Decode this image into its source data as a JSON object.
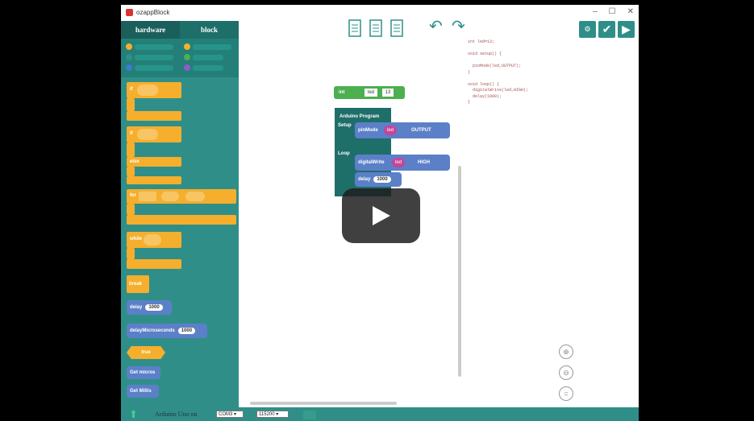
{
  "window": {
    "title": "ozappBlock",
    "controls": [
      "–",
      "☐",
      "✕"
    ]
  },
  "palette": {
    "tabs": [
      {
        "label": "hardware"
      },
      {
        "label": "block"
      }
    ],
    "legend_colors": [
      "#f6ae2d",
      "#2f8f88",
      "#3a7bd5",
      "#f6ae2d",
      "#4caf50",
      "#8e5bc8"
    ],
    "blocks": {
      "if_label": "if",
      "else_label": "else",
      "for_label": "for",
      "while_label": "while",
      "break_label": "break",
      "delay_label": "delay",
      "delay_value": "1000",
      "delay_us_label": "delayMicroseconds",
      "delay_us_value": "1000",
      "true_label": "true",
      "get_micros_label": "Get micros",
      "get_millis_label": "Get Millis"
    }
  },
  "toolbar": {
    "file_icons": [
      "new-file-icon",
      "open-file-icon",
      "save-file-icon"
    ],
    "undo_icon": "↶",
    "redo_icon": "↷",
    "right_buttons": [
      "code-toggle-icon",
      "verify-icon",
      "upload-icon"
    ]
  },
  "workspace": {
    "int_block": {
      "type": "int",
      "name": "led",
      "value": "13"
    },
    "program": {
      "title": "Arduino Program",
      "setup_label": "Setup",
      "loop_label": "Loop",
      "pinmode": {
        "label": "pinMode",
        "pin": "led",
        "mode": "OUTPUT"
      },
      "digitalwrite": {
        "label": "digitalWrite",
        "pin": "led",
        "value": "HIGH"
      },
      "delay": {
        "label": "delay",
        "value": "1000"
      }
    }
  },
  "code": {
    "text": "int led=13;\n\nvoid setup() {\n\n  pinMode(led,OUTPUT);\n}\n\nvoid loop() {\n  digitalWrite(led,HIGH);\n  delay(1000);\n}"
  },
  "status": {
    "board": "Arduino Uno on",
    "port": "COM3",
    "baud": "115200"
  },
  "video": {
    "play_icon": "play-icon"
  }
}
